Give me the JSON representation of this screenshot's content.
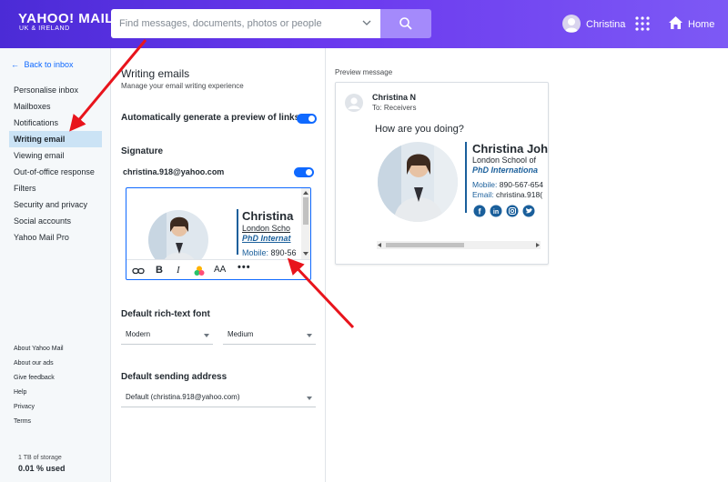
{
  "header": {
    "logo_main": "YAHOO! MAIL",
    "logo_sub": "UK & IRELAND",
    "search_placeholder": "Find messages, documents, photos or people",
    "user_name": "Christina",
    "home_label": "Home"
  },
  "sidebar": {
    "back_label": "Back to inbox",
    "items": [
      {
        "label": "Personalise inbox",
        "active": false
      },
      {
        "label": "Mailboxes",
        "active": false
      },
      {
        "label": "Notifications",
        "active": false
      },
      {
        "label": "Writing email",
        "active": true
      },
      {
        "label": "Viewing email",
        "active": false
      },
      {
        "label": "Out-of-office response",
        "active": false
      },
      {
        "label": "Filters",
        "active": false
      },
      {
        "label": "Security and privacy",
        "active": false
      },
      {
        "label": "Social accounts",
        "active": false
      },
      {
        "label": "Yahoo Mail Pro",
        "active": false
      }
    ],
    "footer_links": [
      "About Yahoo Mail",
      "About our ads",
      "Give feedback",
      "Help",
      "Privacy",
      "Terms"
    ],
    "storage_total": "1 TB of storage",
    "storage_used": "0.01 % used"
  },
  "settings": {
    "title": "Writing emails",
    "subtitle": "Manage your email writing experience",
    "auto_preview_label": "Automatically generate a preview of links",
    "auto_preview_on": true,
    "signature_heading": "Signature",
    "signature_account": "christina.918@yahoo.com",
    "signature_on": true,
    "editor_signature": {
      "name": "Christina",
      "school": "London Scho",
      "degree": "PhD Internat",
      "mobile_key": "Mobile:",
      "mobile_val": "890-56"
    },
    "font_heading": "Default rich-text font",
    "font_family_value": "Modern",
    "font_size_value": "Medium",
    "sending_heading": "Default sending address",
    "sending_value": "Default (christina.918@yahoo.com)"
  },
  "preview": {
    "label": "Preview message",
    "sender": "Christina N",
    "to_line": "To: Receivers",
    "greeting": "How are you doing?",
    "signature": {
      "name": "Christina Joh",
      "school": "London School of",
      "degree": "PhD Internationa",
      "mobile_key": "Mobile:",
      "mobile_val": "890-567-654",
      "email_key": "Email:",
      "email_val": "christina.918("
    },
    "social_icons": [
      "facebook-icon",
      "linkedin-icon",
      "instagram-icon",
      "twitter-icon"
    ]
  },
  "colors": {
    "header_start": "#4b2bd6",
    "header_end": "#7d59f5",
    "accent_blue": "#0f69ff",
    "signature_blue": "#1a5f9b",
    "annotation_red": "#e8141c"
  }
}
